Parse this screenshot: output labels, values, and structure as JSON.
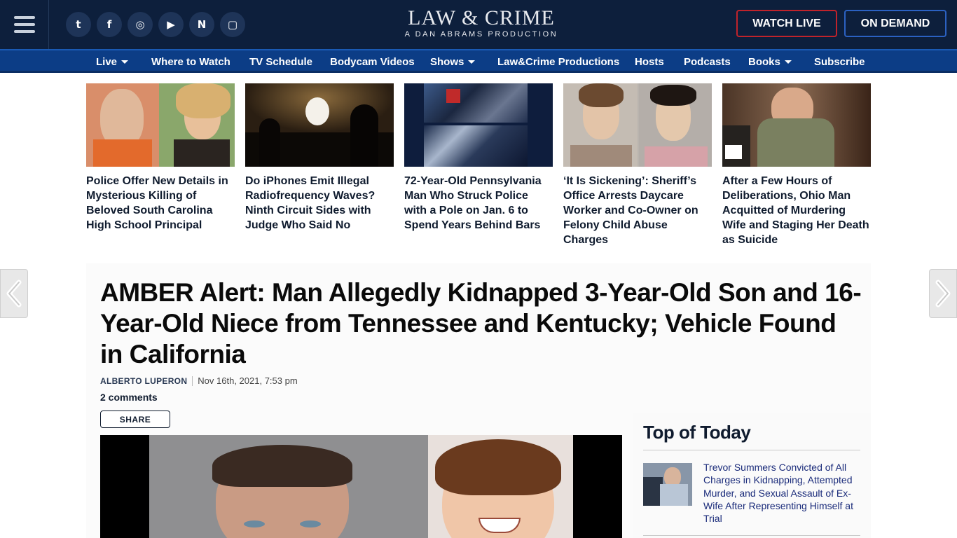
{
  "header": {
    "logo_main": "LAW & CRIME",
    "logo_sub": "A DAN ABRAMS PRODUCTION",
    "social": [
      {
        "name": "twitter-icon",
        "glyph": "t"
      },
      {
        "name": "facebook-icon",
        "glyph": "f"
      },
      {
        "name": "instagram-icon",
        "glyph": "◎"
      },
      {
        "name": "youtube-icon",
        "glyph": "▶"
      },
      {
        "name": "news-icon",
        "glyph": "N"
      },
      {
        "name": "twitch-icon",
        "glyph": "▢"
      }
    ],
    "watch_live": "WATCH LIVE",
    "on_demand": "ON DEMAND"
  },
  "nav": {
    "live": "Live",
    "where_to_watch": "Where to Watch",
    "tv_schedule": "TV Schedule",
    "bodycam": "Bodycam Videos",
    "shows": "Shows",
    "productions": "Law&Crime Productions",
    "hosts": "Hosts",
    "podcasts": "Podcasts",
    "books": "Books",
    "subscribe": "Subscribe"
  },
  "top_stories": [
    {
      "title": "Police Offer New Details in Mysterious Killing of Beloved South Carolina High School Principal"
    },
    {
      "title": "Do iPhones Emit Illegal Radiofrequency Waves? Ninth Circuit Sides with Judge Who Said No"
    },
    {
      "title": "72-Year-Old Pennsylvania Man Who Struck Police with a Pole on Jan. 6 to Spend Years Behind Bars"
    },
    {
      "title": "‘It Is Sickening’: Sheriff’s Office Arrests Daycare Worker and Co-Owner on Felony Child Abuse Charges"
    },
    {
      "title": "After a Few Hours of Deliberations, Ohio Man Acquitted of Murdering Wife and Staging Her Death as Suicide"
    }
  ],
  "article": {
    "headline": "AMBER Alert: Man Allegedly Kidnapped 3-Year-Old Son and 16-Year-Old Niece from Tennessee and Kentucky; Vehicle Found in California",
    "author": "ALBERTO LUPERON",
    "date": "Nov 16th, 2021, 7:53 pm",
    "comments": "2 comments",
    "share": "SHARE"
  },
  "sidebar": {
    "heading": "Top of Today",
    "items": [
      {
        "title": "Trevor Summers Convicted of All Charges in Kidnapping, Attempted Murder, and Sexual Assault of Ex-Wife After Representing Himself at Trial"
      }
    ]
  }
}
